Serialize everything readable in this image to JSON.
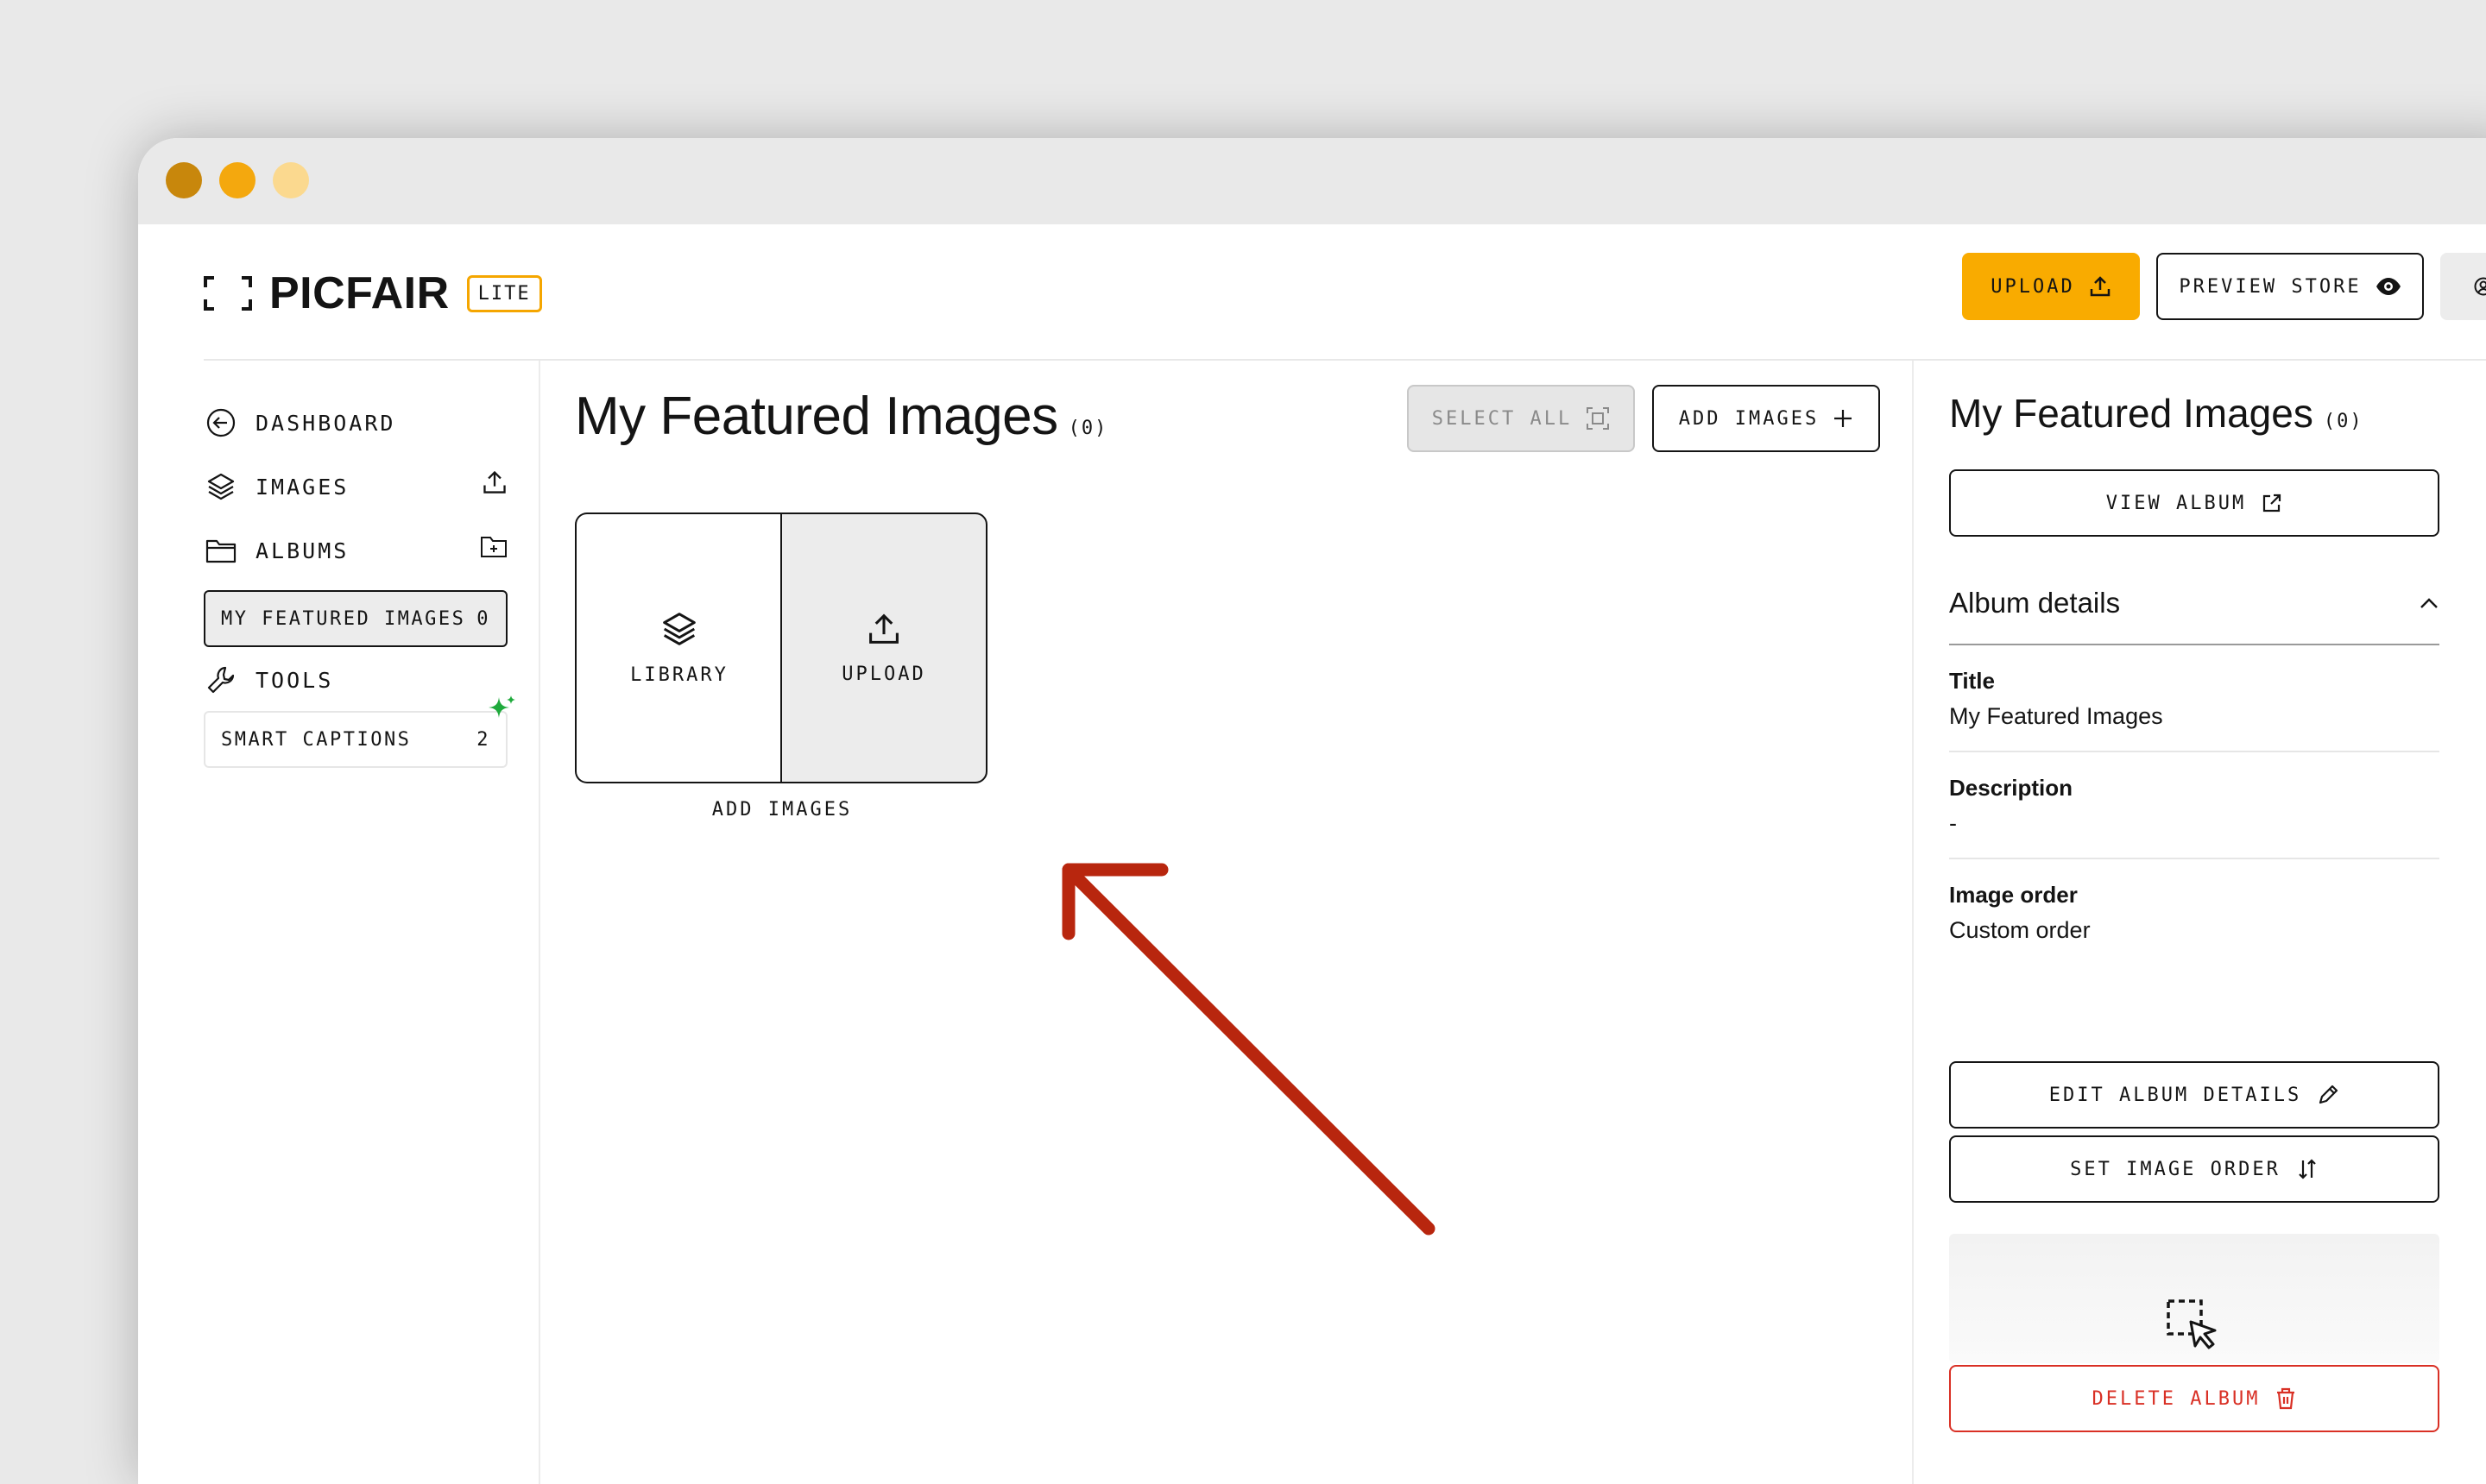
{
  "brand": {
    "name": "PICFAIR",
    "badge": "LITE"
  },
  "header": {
    "upload": "UPLOAD",
    "preview": "PREVIEW STORE"
  },
  "sidebar": {
    "dashboard": "DASHBOARD",
    "images": "IMAGES",
    "albums": "ALBUMS",
    "album_item": {
      "label": "MY FEATURED IMAGES",
      "count": "0"
    },
    "tools": "TOOLS",
    "smart_captions": {
      "label": "SMART CAPTIONS",
      "count": "2"
    }
  },
  "main": {
    "title": "My Featured Images",
    "count": "(0)",
    "select_all": "SELECT ALL",
    "add_images": "ADD IMAGES",
    "tile_library": "LIBRARY",
    "tile_upload": "UPLOAD",
    "tiles_caption": "ADD IMAGES"
  },
  "panel": {
    "title": "My Featured Images",
    "count": "(0)",
    "view_album": "VIEW ALBUM",
    "section": "Album details",
    "fields": [
      {
        "label": "Title",
        "value": "My Featured Images"
      },
      {
        "label": "Description",
        "value": "-"
      },
      {
        "label": "Image order",
        "value": "Custom order"
      }
    ],
    "edit": "EDIT ALBUM DETAILS",
    "order": "SET IMAGE ORDER",
    "delete": "DELETE ALBUM"
  },
  "colors": {
    "accent": "#f9ab00",
    "danger": "#d93025",
    "arrow": "#b8260e",
    "sparkle": "#1faa3c"
  }
}
